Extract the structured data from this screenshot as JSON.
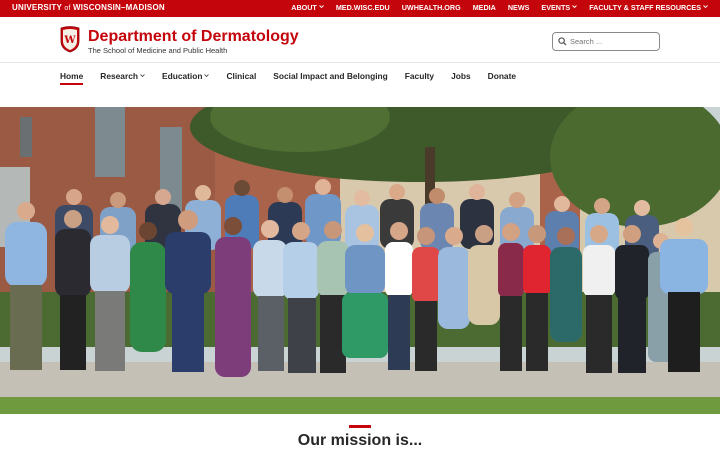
{
  "topbar": {
    "university_prefix": "UNIVERSITY",
    "university_of": "of",
    "university_suffix": "WISCONSIN–MADISON",
    "links": [
      {
        "label": "ABOUT",
        "dropdown": true
      },
      {
        "label": "MED.WISC.EDU",
        "dropdown": false
      },
      {
        "label": "UWHEALTH.ORG",
        "dropdown": false
      },
      {
        "label": "MEDIA",
        "dropdown": false
      },
      {
        "label": "NEWS",
        "dropdown": false
      },
      {
        "label": "EVENTS",
        "dropdown": true
      },
      {
        "label": "FACULTY & STAFF RESOURCES",
        "dropdown": true
      }
    ]
  },
  "header": {
    "title": "Department of Dermatology",
    "subtitle": "The School of Medicine and Public Health",
    "crest_letter": "W"
  },
  "search": {
    "placeholder": "Search ..."
  },
  "nav": {
    "items": [
      {
        "label": "Home",
        "dropdown": false,
        "active": true
      },
      {
        "label": "Research",
        "dropdown": true,
        "active": false
      },
      {
        "label": "Education",
        "dropdown": true,
        "active": false
      },
      {
        "label": "Clinical",
        "dropdown": false,
        "active": false
      },
      {
        "label": "Social Impact and Belonging",
        "dropdown": false,
        "active": false
      },
      {
        "label": "Faculty",
        "dropdown": false,
        "active": false
      },
      {
        "label": "Jobs",
        "dropdown": false,
        "active": false
      },
      {
        "label": "Donate",
        "dropdown": false,
        "active": false
      }
    ]
  },
  "hero": {
    "icon": "group-photo"
  },
  "mission": {
    "heading": "Our mission is..."
  },
  "colors": {
    "brand_red": "#c5050c",
    "text": "#282728"
  }
}
